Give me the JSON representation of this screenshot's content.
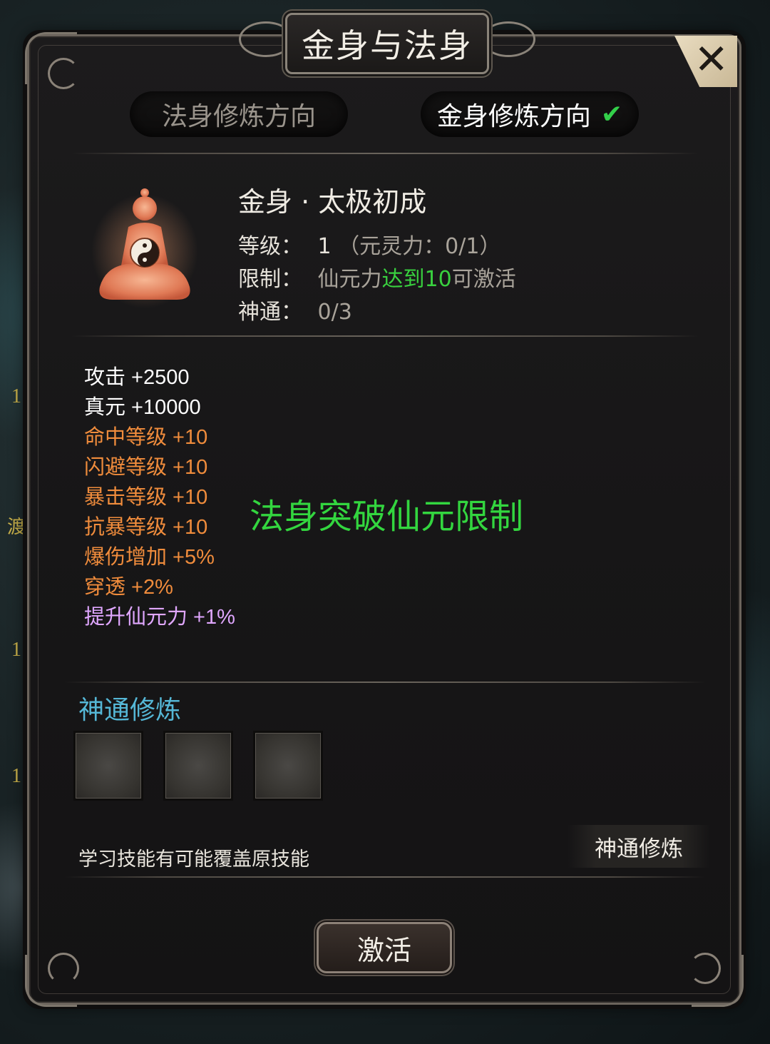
{
  "window": {
    "title": "金身与法身",
    "close_label": "✕"
  },
  "tabs": [
    {
      "label": "法身修炼方向",
      "selected": false
    },
    {
      "label": "金身修炼方向",
      "selected": true,
      "check": "✔"
    }
  ],
  "skill": {
    "name": "金身 · 太极初成",
    "icon": "meditating-figure-taiji-icon",
    "rows": {
      "level": {
        "key": "等级：",
        "value": "1",
        "extra": "（元灵力：0/1）"
      },
      "limit": {
        "key": "限制：",
        "prefix": "仙元力",
        "highlight": "达到10",
        "suffix": "可激活"
      },
      "shentong": {
        "key": "神通：",
        "value": "0/3"
      }
    }
  },
  "attributes": [
    {
      "text": "攻击 +2500",
      "color": "white"
    },
    {
      "text": "真元 +10000",
      "color": "white"
    },
    {
      "text": "命中等级 +10",
      "color": "orange"
    },
    {
      "text": "闪避等级 +10",
      "color": "orange"
    },
    {
      "text": "暴击等级 +10",
      "color": "orange"
    },
    {
      "text": "抗暴等级 +10",
      "color": "orange"
    },
    {
      "text": "爆伤增加 +5%",
      "color": "orange"
    },
    {
      "text": "穿透 +2%",
      "color": "orange"
    },
    {
      "text": "提升仙元力 +1%",
      "color": "purple"
    }
  ],
  "breakthrough": "法身突破仙元限制",
  "shentong_section": {
    "title": "神通修炼",
    "slots": 3,
    "note": "学习技能有可能覆盖原技能",
    "train_button": "神通修炼"
  },
  "activate_button": "激活",
  "background_side_numbers": [
    "1",
    "渡",
    "1",
    "1"
  ],
  "colors": {
    "accent_green": "#33d63f",
    "section_blue": "#55b7d6",
    "orange": "#f08c3c",
    "purple": "#e0a7ff"
  }
}
